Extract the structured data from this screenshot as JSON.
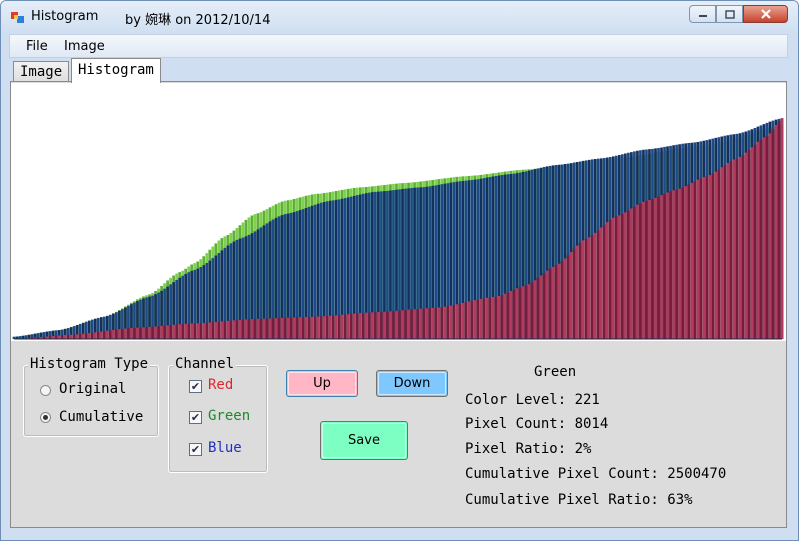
{
  "window": {
    "title": "Histogram",
    "subtitle": "by 婉琳 on 2012/10/14",
    "controls": {
      "minimize": "minimize-icon",
      "maximize": "maximize-icon",
      "close": "close-icon"
    }
  },
  "menu": {
    "items": [
      "File",
      "Image"
    ]
  },
  "tabs": [
    {
      "label": "Image",
      "active": false
    },
    {
      "label": "Histogram",
      "active": true
    }
  ],
  "histogram_type": {
    "title": "Histogram Type",
    "options": [
      {
        "label": "Original",
        "checked": false
      },
      {
        "label": "Cumulative",
        "checked": true
      }
    ]
  },
  "channel": {
    "title": "Channel",
    "items": [
      {
        "label": "Red",
        "checked": true,
        "color": "#e0262d"
      },
      {
        "label": "Green",
        "checked": true,
        "color": "#1a8a2a"
      },
      {
        "label": "Blue",
        "checked": true,
        "color": "#1f2fbf"
      }
    ]
  },
  "buttons": {
    "up": {
      "label": "Up",
      "color": "#ffb7c5"
    },
    "down": {
      "label": "Down",
      "color": "#7fc7ff"
    },
    "save": {
      "label": "Save",
      "color": "#7dffc4"
    }
  },
  "info": {
    "channel_name": "Green",
    "color_level": "Color Level: 221",
    "pixel_count": "Pixel Count: 8014",
    "pixel_ratio": "Pixel Ratio: 2%",
    "cumulative_pixel_count": "Cumulative Pixel Count: 2500470",
    "cumulative_pixel_ratio": "Cumulative Pixel Ratio: 63%"
  },
  "chart_data": {
    "type": "bar",
    "title": "",
    "xlabel": "",
    "ylabel": "",
    "x_range": [
      0,
      255
    ],
    "y_range": [
      0,
      1
    ],
    "grid": false,
    "series": [
      {
        "color": "#1a4a8a",
        "stroke": "#14305f",
        "knots": [
          [
            0,
            0.01
          ],
          [
            15,
            0.04
          ],
          [
            30,
            0.1
          ],
          [
            45,
            0.19
          ],
          [
            60,
            0.31
          ],
          [
            75,
            0.45
          ],
          [
            90,
            0.56
          ],
          [
            105,
            0.62
          ],
          [
            120,
            0.66
          ],
          [
            135,
            0.68
          ],
          [
            150,
            0.71
          ],
          [
            165,
            0.74
          ],
          [
            180,
            0.78
          ],
          [
            195,
            0.81
          ],
          [
            210,
            0.85
          ],
          [
            225,
            0.88
          ],
          [
            240,
            0.92
          ],
          [
            255,
            0.99
          ]
        ]
      },
      {
        "color": "#7cd24a",
        "stroke": "#5fae36",
        "knots": [
          [
            0,
            0.01
          ],
          [
            15,
            0.04
          ],
          [
            30,
            0.1
          ],
          [
            45,
            0.2
          ],
          [
            55,
            0.3
          ],
          [
            60,
            0.34
          ],
          [
            70,
            0.46
          ],
          [
            80,
            0.56
          ],
          [
            90,
            0.62
          ],
          [
            100,
            0.65
          ],
          [
            115,
            0.68
          ],
          [
            130,
            0.7
          ],
          [
            150,
            0.73
          ],
          [
            170,
            0.76
          ],
          [
            200,
            0.81
          ],
          [
            230,
            0.87
          ],
          [
            255,
            0.96
          ]
        ]
      },
      {
        "color": "#7a1a3c",
        "stroke": "#b33a5c",
        "knots": [
          [
            0,
            0.0
          ],
          [
            20,
            0.02
          ],
          [
            40,
            0.05
          ],
          [
            60,
            0.07
          ],
          [
            80,
            0.09
          ],
          [
            100,
            0.1
          ],
          [
            120,
            0.12
          ],
          [
            140,
            0.14
          ],
          [
            160,
            0.19
          ],
          [
            170,
            0.24
          ],
          [
            180,
            0.33
          ],
          [
            190,
            0.45
          ],
          [
            200,
            0.55
          ],
          [
            210,
            0.62
          ],
          [
            220,
            0.67
          ],
          [
            230,
            0.73
          ],
          [
            240,
            0.81
          ],
          [
            250,
            0.91
          ],
          [
            255,
            0.99
          ]
        ]
      }
    ]
  }
}
